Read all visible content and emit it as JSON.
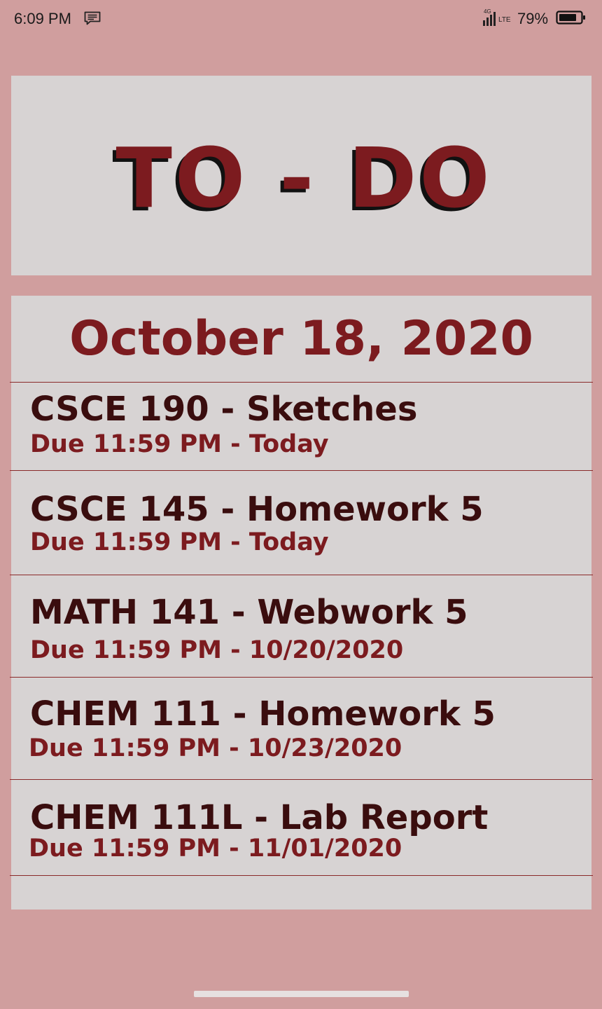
{
  "status_bar": {
    "time": "6:09 PM",
    "network": "4G",
    "network_type": "LTE",
    "battery": "79%",
    "icons": [
      "message-icon",
      "signal-icon",
      "battery-icon"
    ]
  },
  "header": {
    "title": "TO - DO"
  },
  "list": {
    "date": "October 18, 2020",
    "tasks": [
      {
        "title": "CSCE 190 - Sketches",
        "due": "Due 11:59 PM - Today"
      },
      {
        "title": "CSCE 145 - Homework 5",
        "due": "Due 11:59 PM - Today"
      },
      {
        "title": "MATH 141 - Webwork 5",
        "due": "Due 11:59 PM - 10/20/2020"
      },
      {
        "title": "CHEM 111 - Homework 5",
        "due": "Due 11:59 PM - 10/23/2020"
      },
      {
        "title": "CHEM 111L - Lab Report",
        "due": "Due 11:59 PM - 11/01/2020"
      }
    ]
  },
  "colors": {
    "background": "#d09e9e",
    "card": "#d7d3d3",
    "accent": "#7c1b1f",
    "task_title": "#3a0d0e"
  }
}
